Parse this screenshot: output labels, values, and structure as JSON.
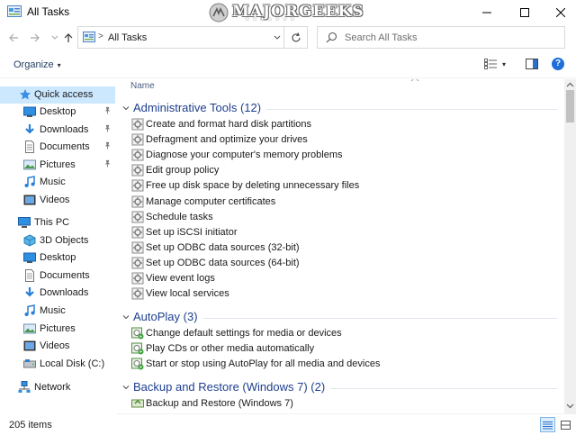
{
  "window": {
    "title": "All Tasks",
    "watermark": "MAJORGEEKS",
    "watermark_stars": "★★★★★★★",
    "controls": {
      "minimize": "minimize-icon",
      "maximize": "maximize-icon",
      "close": "close-icon"
    }
  },
  "address": {
    "separator": ">",
    "path": "All Tasks",
    "search_placeholder": "Search All Tasks"
  },
  "toolbar": {
    "organize_label": "Organize",
    "caret": "▾"
  },
  "nav": {
    "quick_access": "Quick access",
    "quick_items": [
      {
        "label": "Desktop",
        "icon": "desktop-icon",
        "pinned": true
      },
      {
        "label": "Downloads",
        "icon": "downloads-icon",
        "pinned": true
      },
      {
        "label": "Documents",
        "icon": "documents-icon",
        "pinned": true
      },
      {
        "label": "Pictures",
        "icon": "pictures-icon",
        "pinned": true
      },
      {
        "label": "Music",
        "icon": "music-icon",
        "pinned": false
      },
      {
        "label": "Videos",
        "icon": "videos-icon",
        "pinned": false
      }
    ],
    "this_pc": "This PC",
    "pc_items": [
      {
        "label": "3D Objects",
        "icon": "3d-objects-icon"
      },
      {
        "label": "Desktop",
        "icon": "desktop-icon"
      },
      {
        "label": "Documents",
        "icon": "documents-icon"
      },
      {
        "label": "Downloads",
        "icon": "downloads-icon"
      },
      {
        "label": "Music",
        "icon": "music-icon"
      },
      {
        "label": "Pictures",
        "icon": "pictures-icon"
      },
      {
        "label": "Videos",
        "icon": "videos-icon"
      },
      {
        "label": "Local Disk (C:)",
        "icon": "local-disk-icon"
      }
    ],
    "network": "Network"
  },
  "content": {
    "column_header": "Name",
    "groups": [
      {
        "name": "Administrative Tools (12)",
        "icon": "admin-tools-icon",
        "tasks": [
          "Create and format hard disk partitions",
          "Defragment and optimize your drives",
          "Diagnose your computer's memory problems",
          "Edit group policy",
          "Free up disk space by deleting unnecessary files",
          "Manage computer certificates",
          "Schedule tasks",
          "Set up iSCSI initiator",
          "Set up ODBC data sources (32-bit)",
          "Set up ODBC data sources (64-bit)",
          "View event logs",
          "View local services"
        ]
      },
      {
        "name": "AutoPlay (3)",
        "icon": "autoplay-icon",
        "tasks": [
          "Change default settings for media or devices",
          "Play CDs or other media automatically",
          "Start or stop using AutoPlay for all media and devices"
        ]
      },
      {
        "name": "Backup and Restore (Windows 7) (2)",
        "icon": "backup-icon",
        "tasks": [
          "Backup and Restore (Windows 7)"
        ]
      }
    ]
  },
  "status": {
    "item_count": "205 items"
  },
  "colors": {
    "accent": "#1e6fd9",
    "selected_bg": "#cce8ff",
    "group_header": "#1e3f8f"
  }
}
